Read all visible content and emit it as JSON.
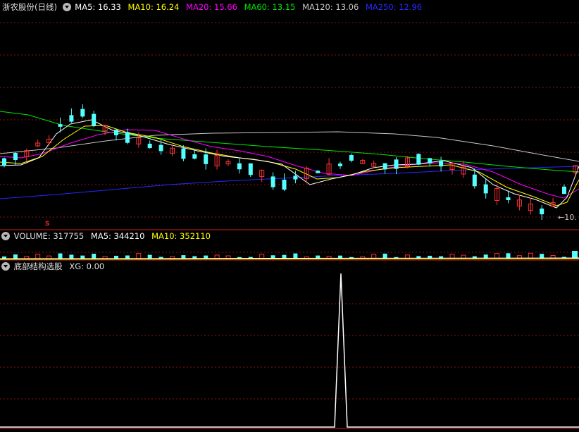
{
  "main_panel": {
    "stock_name": "浙农股份(日线)",
    "ma5_label": "MA5: 16.33",
    "ma10_label": "MA10: 16.24",
    "ma20_label": "MA20: 15.66",
    "ma60_label": "MA60: 13.15",
    "ma120_label": "MA120: 13.06",
    "ma250_label": "MA250: 12.96",
    "low_marker": "10.",
    "signal_marker": "S"
  },
  "volume_panel": {
    "volume_label": "VOLUME: 317755",
    "ma5_label": "MA5: 344210",
    "ma10_label": "MA10: 352110"
  },
  "indicator_panel": {
    "name": "底部结构选股",
    "xg_label": "XG: 0.00"
  },
  "colors": {
    "up": "#ff3232",
    "down": "#54ffff",
    "ma5": "#ffffff",
    "ma10": "#ffff00",
    "ma20": "#ff00ff",
    "ma60": "#00e600",
    "ma120": "#c8c8c8",
    "ma250": "#2828ff",
    "grid": "#8b1010"
  },
  "chart_data": {
    "type": "candlestick",
    "title": "浙农股份(日线)",
    "moving_averages": {
      "MA5": 16.33,
      "MA10": 16.24,
      "MA20": 15.66,
      "MA60": 13.15,
      "MA120": 13.06,
      "MA250": 12.96
    },
    "volume": 317755,
    "volume_ma5": 344210,
    "volume_ma10": 352110,
    "indicator": {
      "name": "底部结构选股",
      "XG": 0.0,
      "signal_count": 1
    }
  }
}
